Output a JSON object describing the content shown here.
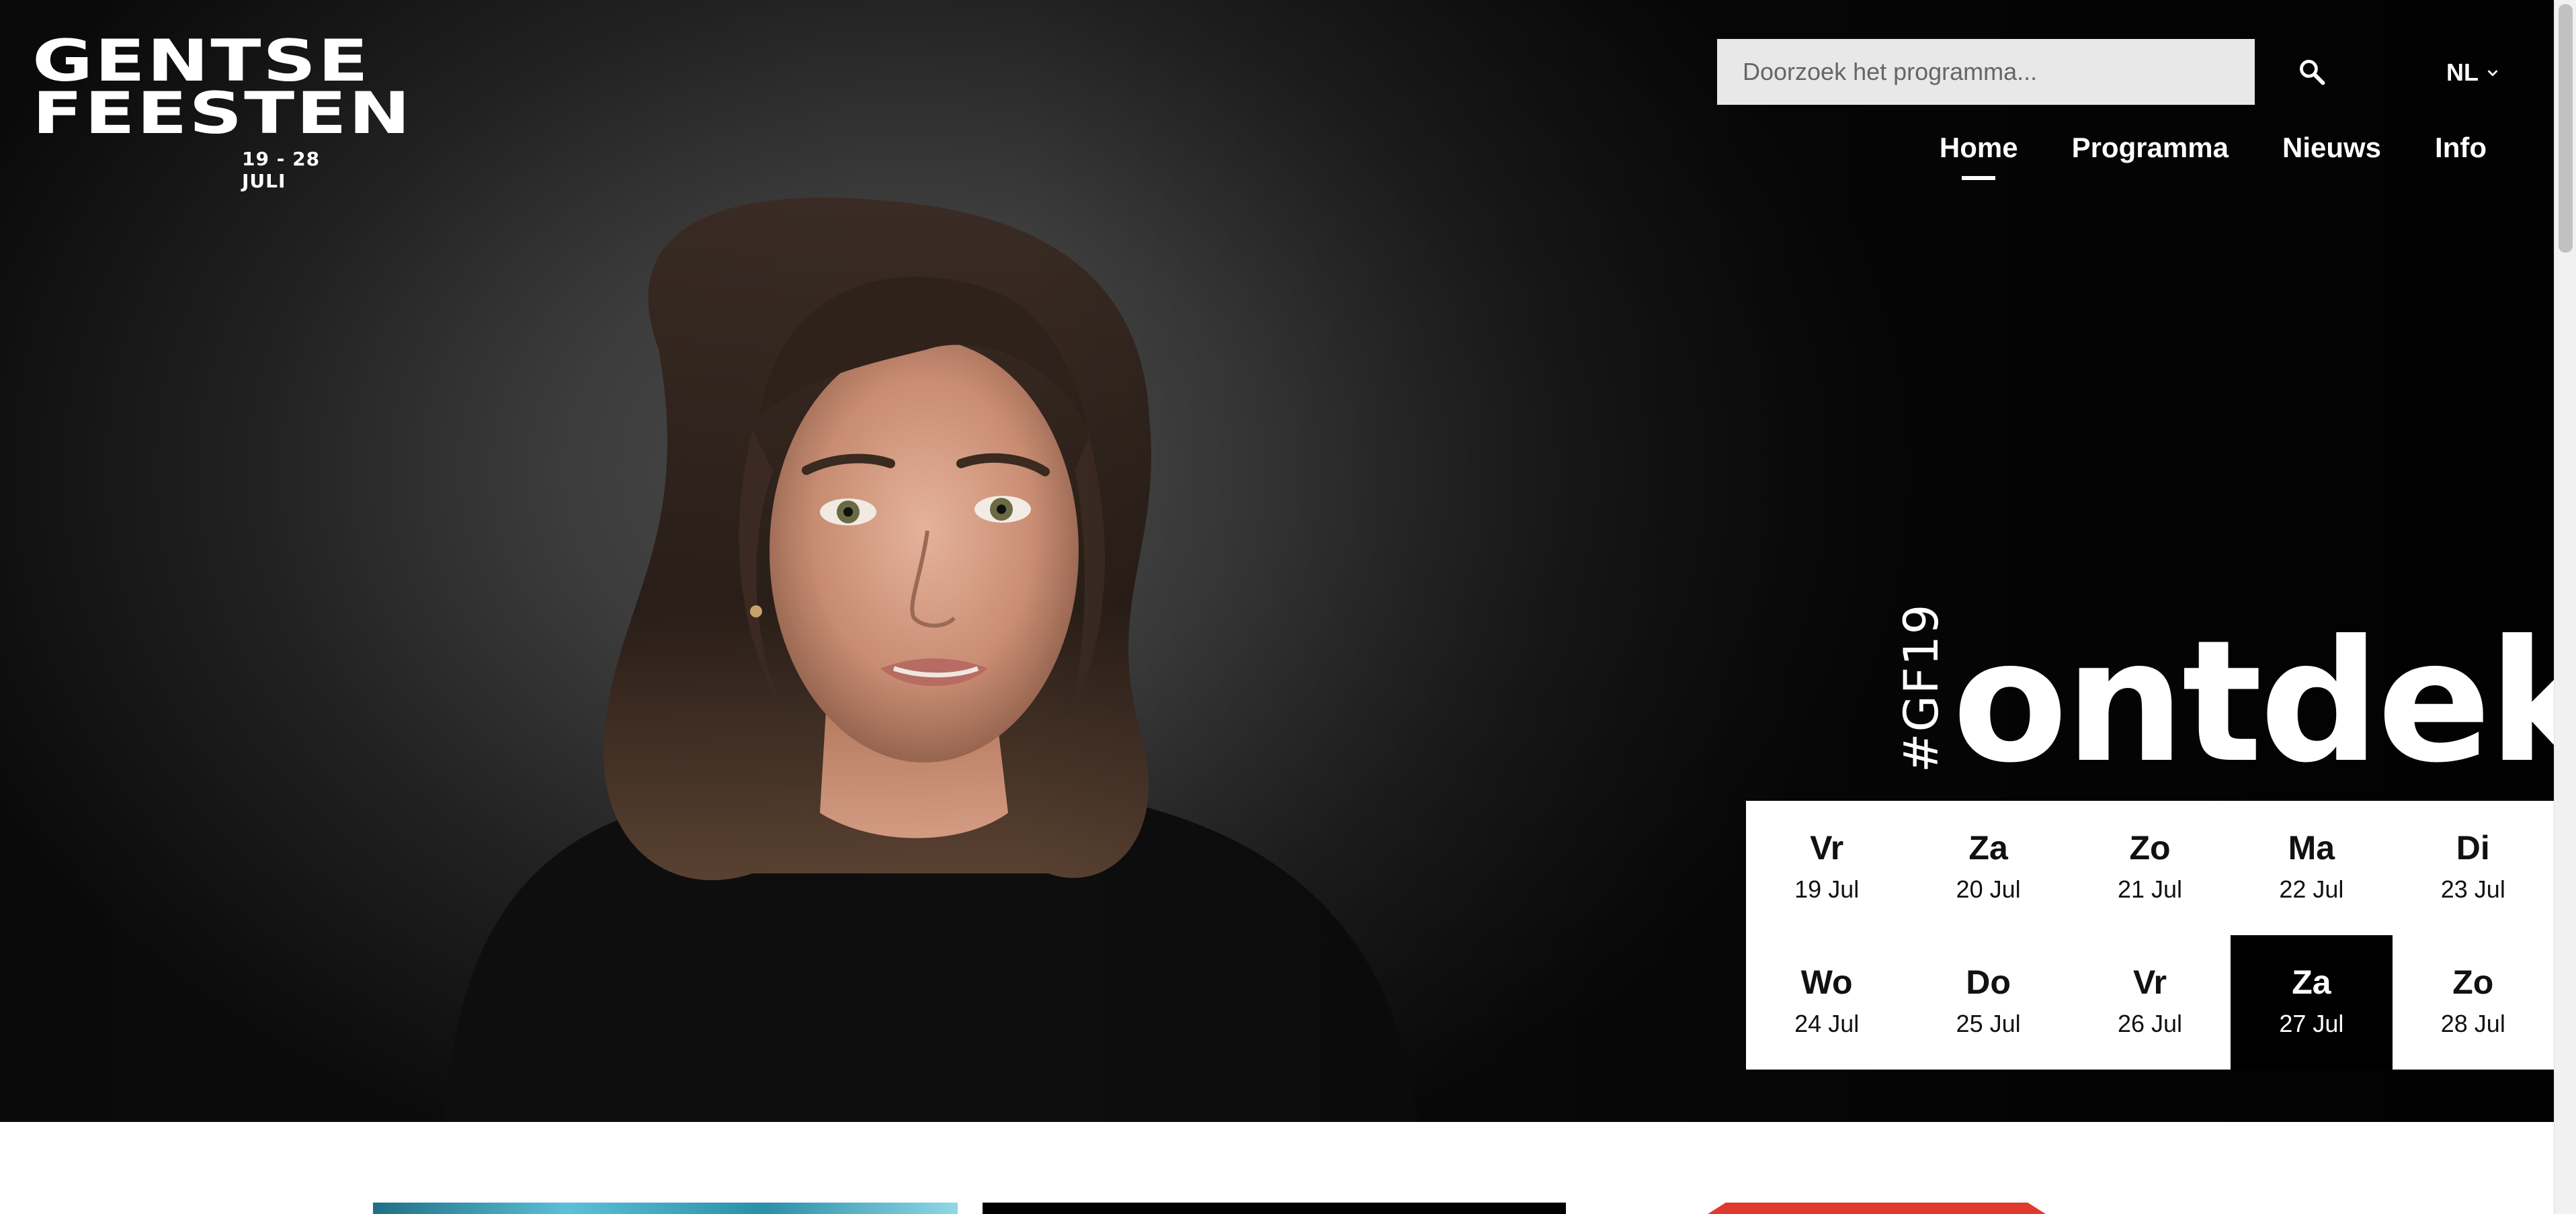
{
  "logo": {
    "line1": "GENTSE",
    "line2": "FEESTEN",
    "dates": "19 - 28 JULI"
  },
  "search": {
    "placeholder": "Doorzoek het programma..."
  },
  "language": {
    "current": "NL"
  },
  "nav": {
    "items": [
      {
        "label": "Home",
        "active": true
      },
      {
        "label": "Programma",
        "active": false
      },
      {
        "label": "Nieuws",
        "active": false
      },
      {
        "label": "Info",
        "active": false
      }
    ]
  },
  "hero": {
    "hashtag": "#GF19",
    "headline": "ontdek"
  },
  "calendar": {
    "days": [
      {
        "day": "Vr",
        "date": "19 Jul",
        "selected": false
      },
      {
        "day": "Za",
        "date": "20 Jul",
        "selected": false
      },
      {
        "day": "Zo",
        "date": "21 Jul",
        "selected": false
      },
      {
        "day": "Ma",
        "date": "22 Jul",
        "selected": false
      },
      {
        "day": "Di",
        "date": "23 Jul",
        "selected": false
      },
      {
        "day": "Wo",
        "date": "24 Jul",
        "selected": false
      },
      {
        "day": "Do",
        "date": "25 Jul",
        "selected": false
      },
      {
        "day": "Vr",
        "date": "26 Jul",
        "selected": false
      },
      {
        "day": "Za",
        "date": "27 Jul",
        "selected": true
      },
      {
        "day": "Zo",
        "date": "28 Jul",
        "selected": false
      }
    ]
  },
  "icons": {
    "search": "search-icon",
    "language_dropdown": "chevron-down-icon"
  },
  "colors": {
    "hero_bg": "#111111",
    "search_bg": "#e8e8e8",
    "selected_date_bg": "#000000",
    "text_on_dark": "#ffffff"
  }
}
